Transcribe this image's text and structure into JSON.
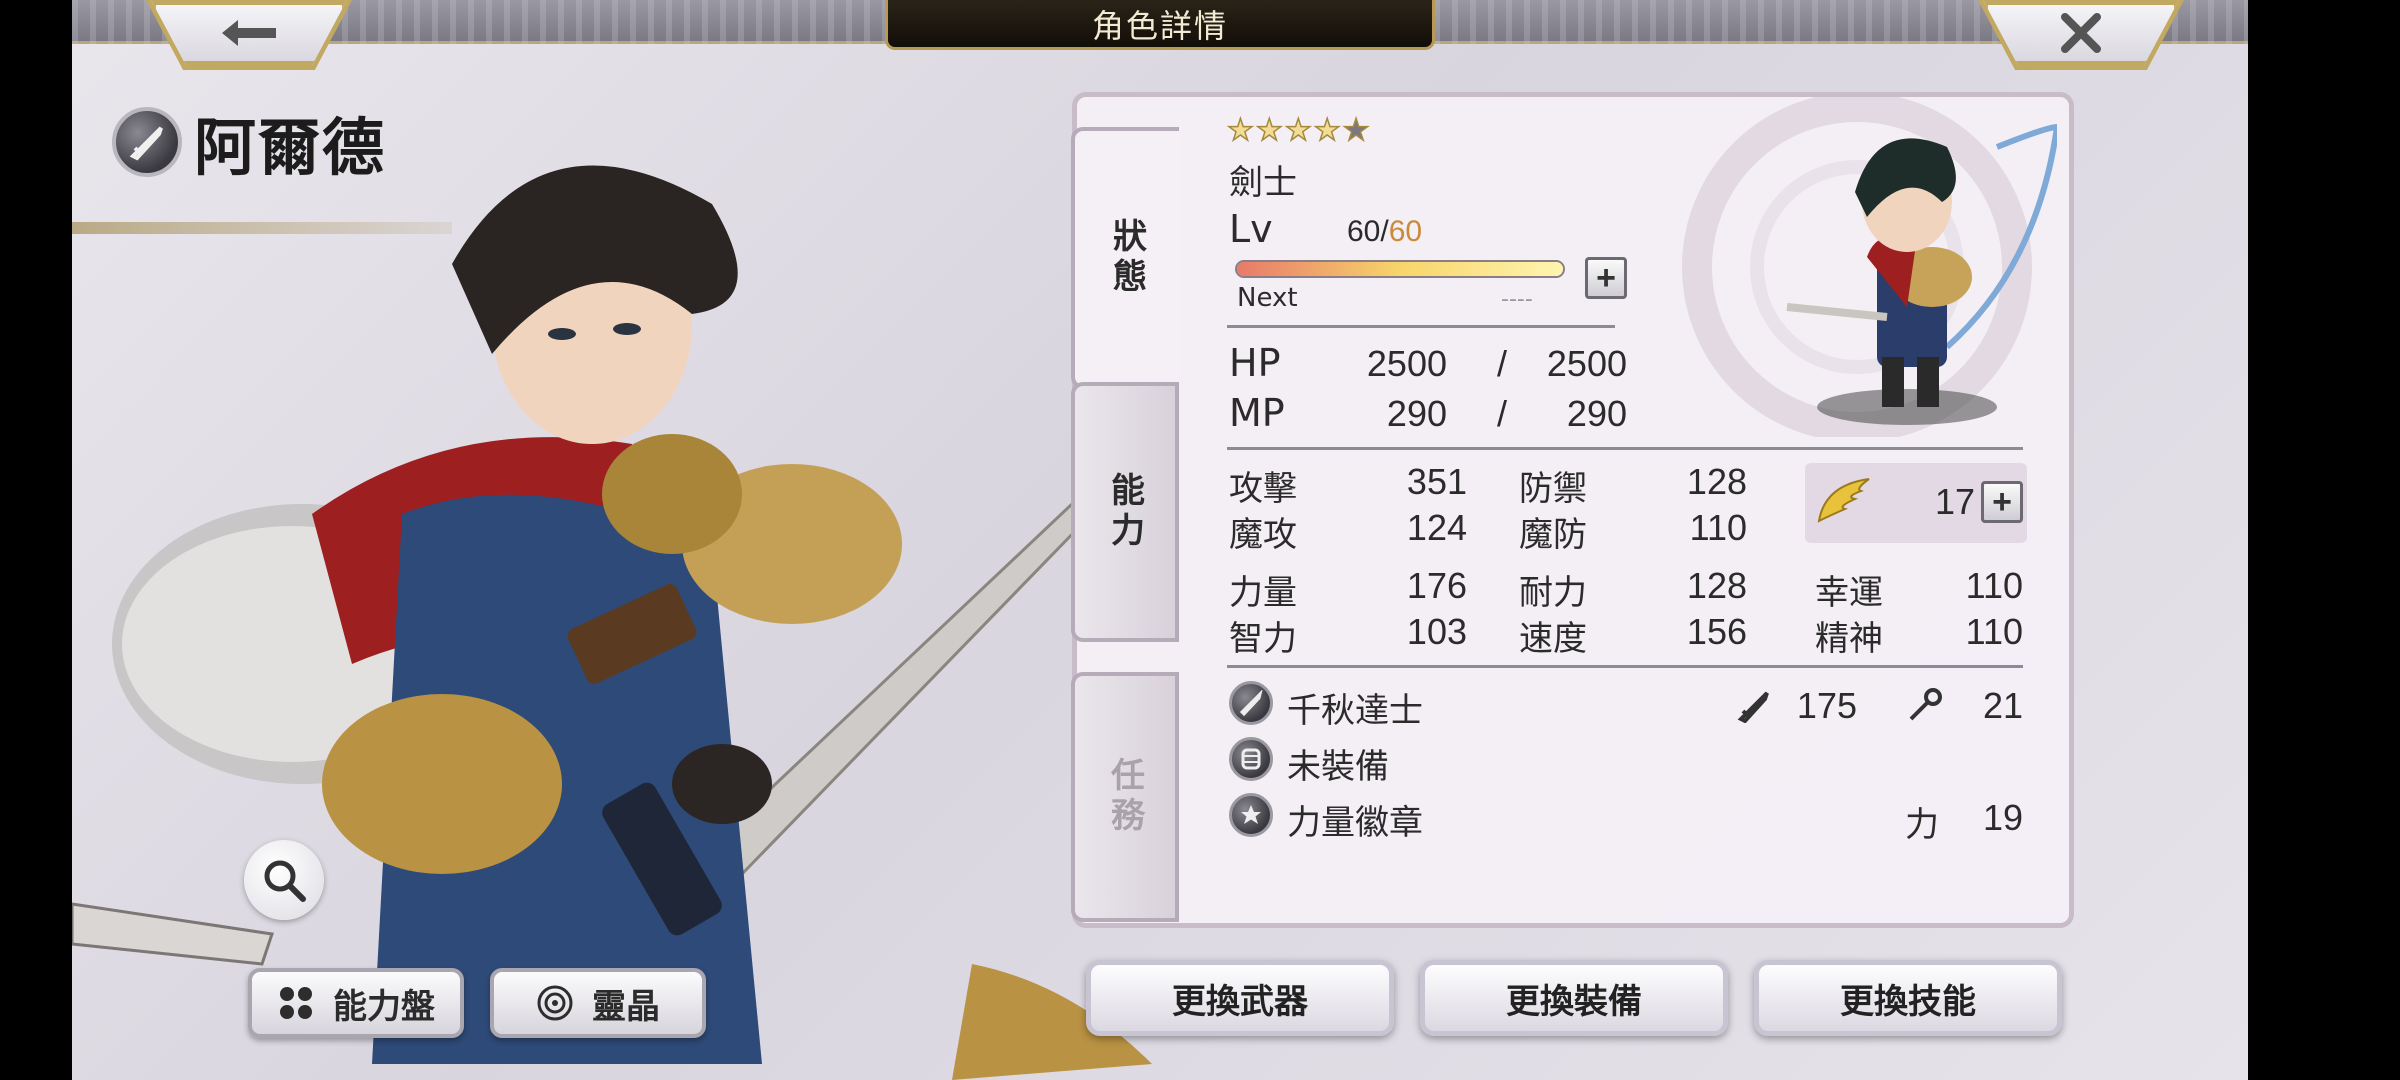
{
  "header": {
    "title": "角色詳情",
    "back_icon": "left-arrow-icon",
    "close_icon": "close-icon"
  },
  "character": {
    "name": "阿爾德",
    "class_icon": "sword-icon",
    "job": "劍士",
    "stars_filled": 4,
    "stars_total": 5
  },
  "tabs": [
    {
      "label": "狀態",
      "state": "active"
    },
    {
      "label": "能力",
      "state": "normal"
    },
    {
      "label": "任務",
      "state": "disabled"
    }
  ],
  "status": {
    "lv_label": "Lv",
    "lv_current": "60",
    "lv_sep": "/",
    "lv_max": "60",
    "exp_fill": 1.0,
    "next_label": "Next",
    "next_value": "----",
    "hp_label": "HP",
    "hp_current": "2500",
    "hp_sep": "/",
    "hp_max": "2500",
    "mp_label": "MP",
    "mp_current": "290",
    "mp_sep": "/",
    "mp_max": "290"
  },
  "stats": {
    "atk_label": "攻擊",
    "atk": "351",
    "def_label": "防禦",
    "def": "128",
    "matk_label": "魔攻",
    "matk": "124",
    "mdef_label": "魔防",
    "mdef": "110",
    "str_label": "力量",
    "str": "176",
    "vit_label": "耐力",
    "vit": "128",
    "luk_label": "幸運",
    "luk": "110",
    "int_label": "智力",
    "int": "103",
    "spd_label": "速度",
    "spd": "156",
    "spi_label": "精神",
    "spi": "110",
    "wing_icon": "wing-icon",
    "wing_value": "17"
  },
  "equipment": [
    {
      "icon": "sword-icon",
      "name": "千秋達士",
      "stat1_icon": "sword-small-icon",
      "stat1": "175",
      "stat2_icon": "staff-icon",
      "stat2": "21"
    },
    {
      "icon": "armor-icon",
      "name": "未裝備"
    },
    {
      "icon": "badge-icon",
      "name": "力量徽章",
      "stat_label": "力",
      "stat": "19"
    }
  ],
  "bottom_left": {
    "board_label": "能力盤",
    "crystal_label": "靈晶"
  },
  "actions": {
    "weapon": "更換武器",
    "equip": "更換裝備",
    "skill": "更換技能"
  },
  "colors": {
    "gold": "#c2a962",
    "lv_max": "#c98a3a",
    "panel_border": "#c8bcc9"
  }
}
